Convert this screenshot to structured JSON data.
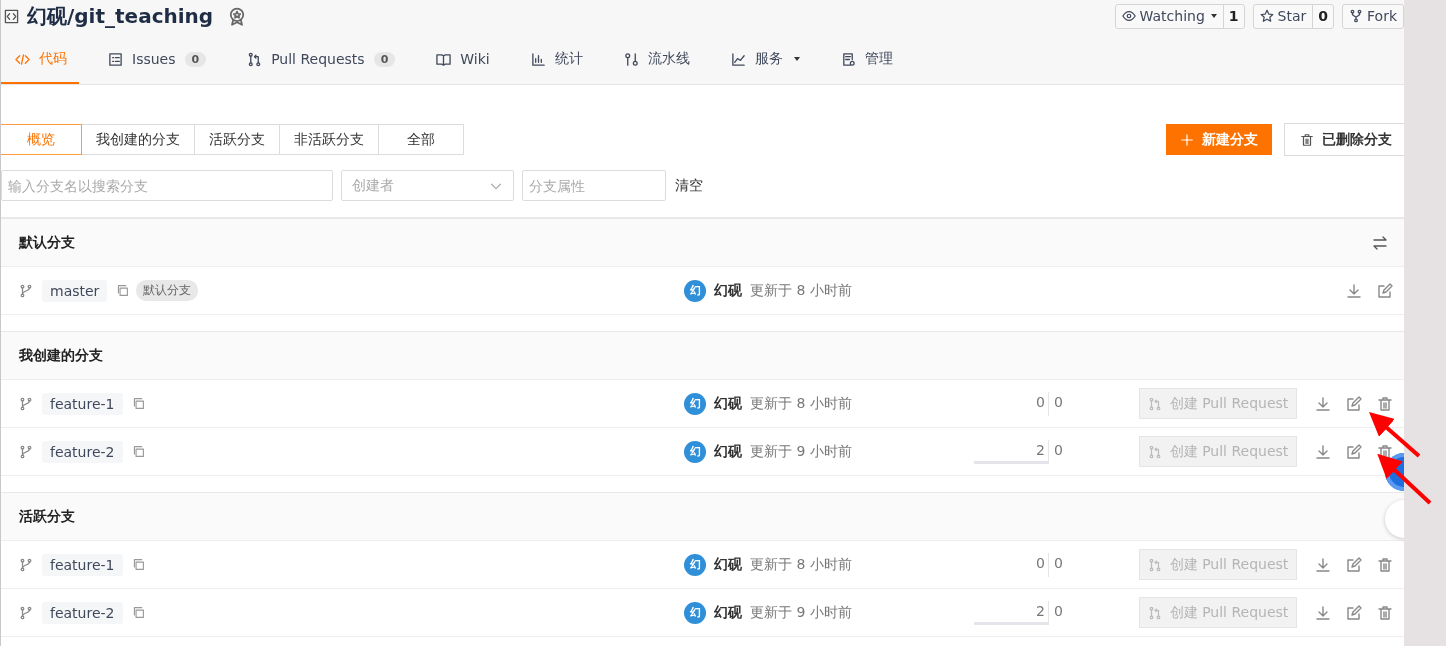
{
  "repo": {
    "title": "幻砚/git_teaching"
  },
  "repo_actions": [
    {
      "kind": "watch",
      "label": "Watching",
      "count": "1"
    },
    {
      "kind": "star",
      "label": "Star",
      "count": "0"
    },
    {
      "kind": "fork",
      "label": "Fork"
    }
  ],
  "nav_tabs": [
    {
      "kind": "code",
      "label": "代码",
      "selected": true
    },
    {
      "kind": "issues",
      "label": "Issues",
      "count": "0",
      "selected": false
    },
    {
      "kind": "pr",
      "label": "Pull Requests",
      "count": "0",
      "selected": false
    },
    {
      "kind": "wiki",
      "label": "Wiki",
      "selected": false
    },
    {
      "kind": "stats",
      "label": "统计",
      "selected": false
    },
    {
      "kind": "pipeline",
      "label": "流水线",
      "selected": false
    },
    {
      "kind": "service",
      "label": "服务",
      "dropdown": true,
      "selected": false
    },
    {
      "kind": "manage",
      "label": "管理",
      "selected": false
    }
  ],
  "branch_filters": [
    {
      "label": "概览",
      "selected": true
    },
    {
      "label": "我创建的分支",
      "selected": false
    },
    {
      "label": "活跃分支",
      "selected": false
    },
    {
      "label": "非活跃分支",
      "selected": false
    },
    {
      "label": "全部",
      "selected": false
    }
  ],
  "new_branch_button": "新建分支",
  "deleted_branches_button": "已删除分支",
  "search": {
    "placeholder": "输入分支名以搜索分支"
  },
  "creator_select": {
    "placeholder": "创建者"
  },
  "attribute_field": {
    "placeholder": "分支属性"
  },
  "clear_link": "清空",
  "sections": [
    {
      "title": "默认分支",
      "switch_icon": true,
      "branches": [
        {
          "name": "master",
          "tag": "默认分支",
          "avatar": "幻",
          "author": "幻砚",
          "updated": "更新于 8 小时前"
        }
      ]
    },
    {
      "title": "我创建的分支",
      "branches": [
        {
          "name": "feature-1",
          "avatar": "幻",
          "author": "幻砚",
          "updated": "更新于 8 小时前",
          "behind": "0",
          "ahead": "0",
          "level": 0,
          "pr_button": "创建 Pull Request",
          "deletable": true
        },
        {
          "name": "feature-2",
          "avatar": "幻",
          "author": "幻砚",
          "updated": "更新于 9 小时前",
          "behind": "2",
          "ahead": "0",
          "level": 1,
          "pr_button": "创建 Pull Request",
          "deletable": true
        }
      ]
    },
    {
      "title": "活跃分支",
      "branches": [
        {
          "name": "feature-1",
          "avatar": "幻",
          "author": "幻砚",
          "updated": "更新于 8 小时前",
          "behind": "0",
          "ahead": "0",
          "level": 0,
          "pr_button": "创建 Pull Request",
          "deletable": true
        },
        {
          "name": "feature-2",
          "avatar": "幻",
          "author": "幻砚",
          "updated": "更新于 9 小时前",
          "behind": "2",
          "ahead": "0",
          "level": 1,
          "pr_button": "创建 Pull Request",
          "deletable": true
        }
      ]
    }
  ]
}
